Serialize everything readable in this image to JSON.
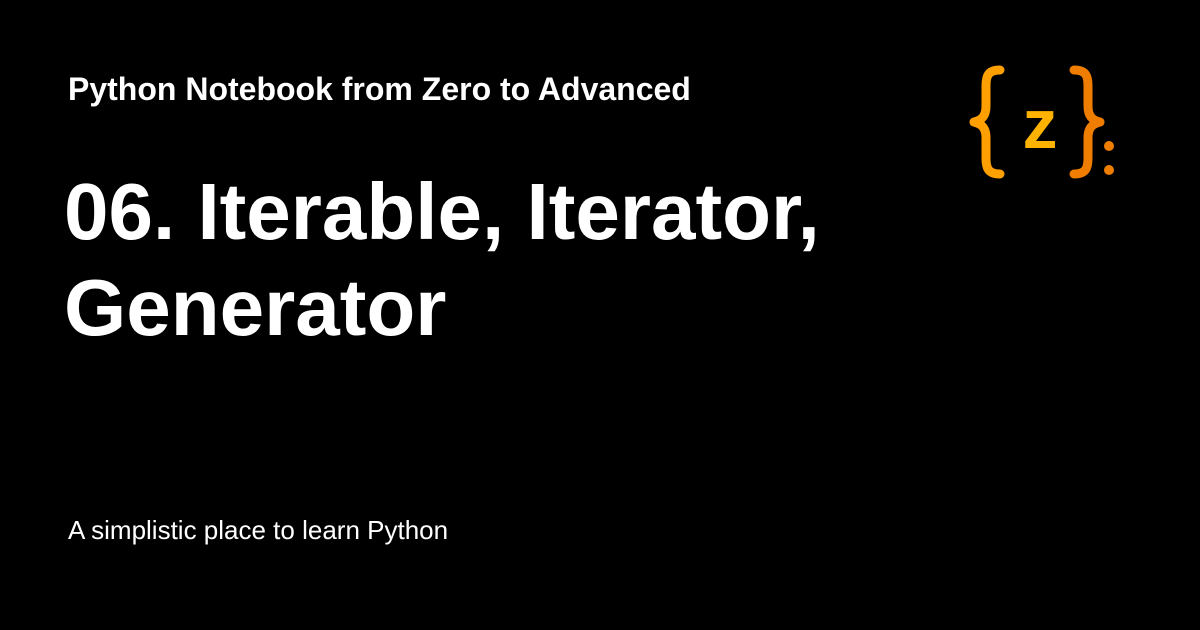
{
  "site": {
    "name": "Python Notebook from Zero to Advanced"
  },
  "page": {
    "title": "06. Iterable, Iterator, Generator",
    "tagline": "A simplistic place to learn Python"
  },
  "logo": {
    "icon": "curly-braces-z-logo",
    "letter": "z",
    "colors": {
      "left_brace": "#ffa000",
      "letter": "#ffb300",
      "right_brace": "#ef7d00",
      "colon": "#ef7d00"
    }
  },
  "theme": {
    "background": "#000000",
    "text": "#ffffff"
  }
}
